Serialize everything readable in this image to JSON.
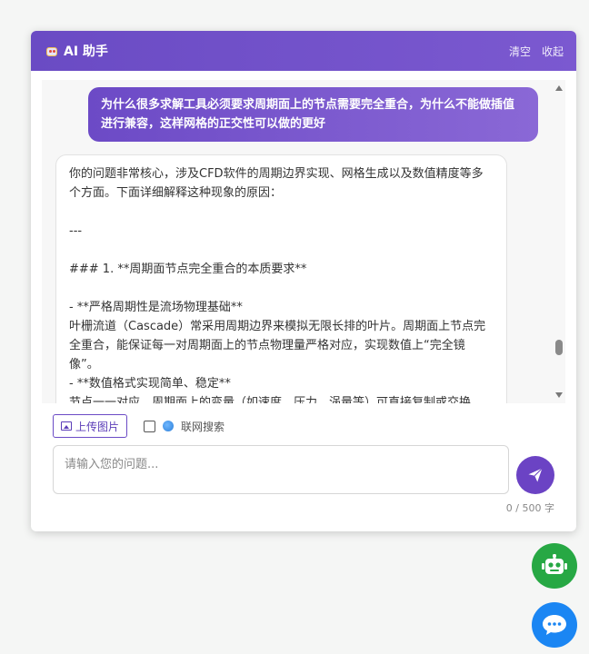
{
  "header": {
    "title": "AI 助手",
    "clear_label": "清空",
    "collapse_label": "收起"
  },
  "chat": {
    "user_message": "为什么很多求解工具必须要求周期面上的节点需要完全重合，为什么不能做插值进行兼容，这样网格的正交性可以做的更好",
    "ai_message": "你的问题非常核心，涉及CFD软件的周期边界实现、网格生成以及数值精度等多个方面。下面详细解释这种现象的原因：\n\n---\n\n### 1. **周期面节点完全重合的本质要求**\n\n- **严格周期性是流场物理基础**\n叶栅流道（Cascade）常采用周期边界来模拟无限长排的叶片。周期面上节点完全重合，能保证每一对周期面上的节点物理量严格对应，实现数值上“完全镜像”。\n- **数值格式实现简单、稳定**\n节点一一对应，周期面上的变量（如速度、压力、涡量等）可直接复制或交换，求解器实现简洁，效率高，不需实时插值运算，减少数据调用和内存消耗。"
  },
  "toolbar": {
    "upload_label": "上传图片",
    "web_search_label": "联网搜索",
    "web_search_checked": false
  },
  "input": {
    "placeholder": "请输入您的问题...",
    "value": "",
    "counter": "0 / 500 字"
  },
  "colors": {
    "accent": "#6b43c4",
    "robot_fab": "#27a844",
    "chat_fab": "#1b86f3"
  },
  "icons": {
    "header": "robot-icon",
    "upload": "image-icon",
    "search": "globe-icon",
    "send": "paper-plane-icon",
    "fab_robot": "robot-icon",
    "fab_chat": "chat-bubble-icon"
  }
}
